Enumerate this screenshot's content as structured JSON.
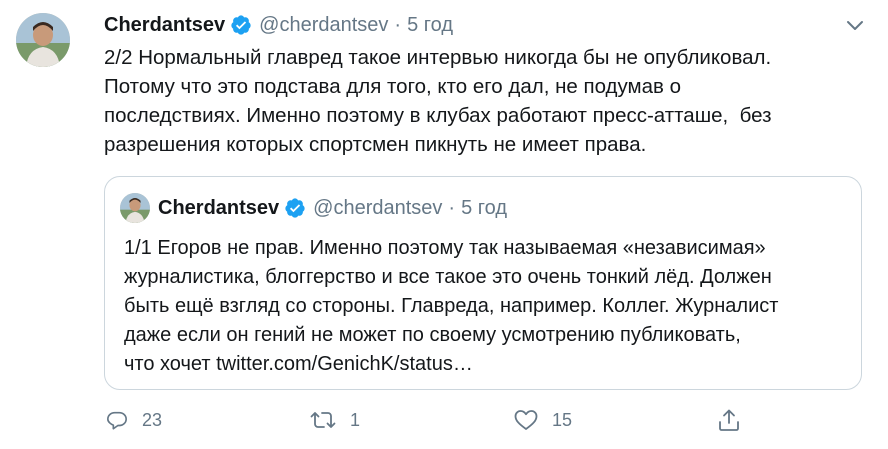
{
  "tweet": {
    "author_name": "Cherdantsev",
    "handle": "@cherdantsev",
    "separator": "·",
    "time": "5 год",
    "text": "2/2 Нормальный главред такое интервью никогда бы не опубликовал.\nПотому что это подстава для того, кто его дал, не подумав о\nпоследствиях. Именно поэтому в клубах работают пресс-атташе,  без\nразрешения которых спортсмен пикнуть не имеет права."
  },
  "quote": {
    "author_name": "Cherdantsev",
    "handle": "@cherdantsev",
    "separator": "·",
    "time": "5 год",
    "text": "1/1 Егоров не прав. Именно поэтому так называемая «независимая»\nжурналистика, блоггерство и все такое это очень тонкий лёд. Должен\nбыть ещё взгляд со стороны. Главреда, например. Коллег. Журналист\nдаже если он гений не может по своему усмотрению публиковать,\nчто хочет twitter.com/GenichK/status…"
  },
  "actions": {
    "reply_count": "23",
    "retweet_count": "1",
    "like_count": "15"
  },
  "colors": {
    "verified": "#1da1f2",
    "secondary_text": "#657786",
    "border": "#ccd6dd"
  },
  "icons": {
    "verified": "verified-badge-icon",
    "caret": "chevron-down-icon",
    "reply": "reply-icon",
    "retweet": "retweet-icon",
    "like": "heart-icon",
    "share": "share-icon"
  }
}
